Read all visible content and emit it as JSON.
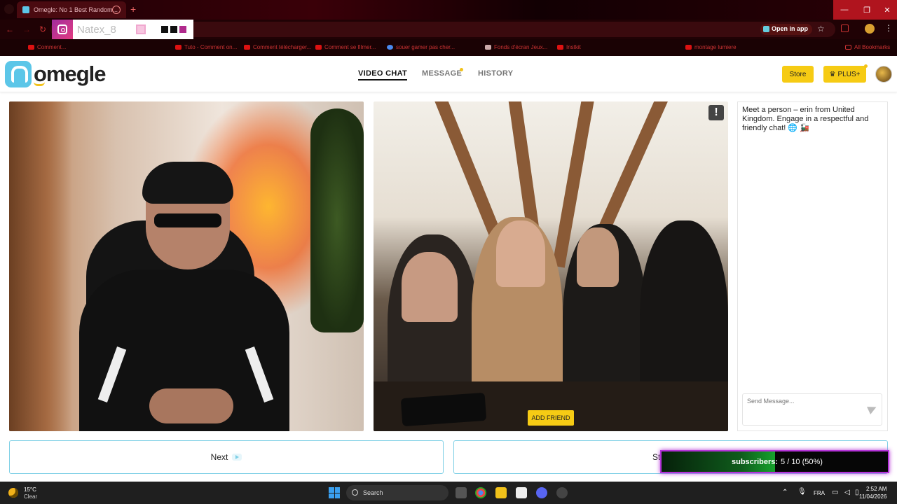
{
  "browser": {
    "tab_title": "Omegle: No 1 Best Random...",
    "open_in_app": "Open in app",
    "bookmarks": [
      "Comment...",
      "Tuto - Comment on...",
      "Comment télécharger...",
      "Comment se filmer...",
      "souer gamer pas cher...",
      "Fonds d'écran Jeux...",
      "Instkit",
      "montage lumiere",
      "All Bookmarks"
    ]
  },
  "overlay": {
    "handle": "Natex_8"
  },
  "header": {
    "logo": "omegle",
    "nav": [
      "VIDEO CHAT",
      "MESSAGE",
      "HISTORY"
    ],
    "store_label": "Store",
    "plus_label": "PLUS+"
  },
  "remote_video": {
    "report_label": "!",
    "add_friend_label": "ADD FRIEND"
  },
  "chat": {
    "intro": "Meet a person – erin from United Kingdom. Engage in a respectful and friendly chat! 🌐 🚂",
    "placeholder": "Send Message..."
  },
  "controls": {
    "next_label": "Next",
    "stop_label": "Stop"
  },
  "subscribers": {
    "label": "subscribers:",
    "count": "5 / 10 (50%)",
    "progress": 0.5
  },
  "taskbar": {
    "temperature": "15°C",
    "condition": "Clear",
    "search_label": "Search",
    "language": "FRA",
    "time": "2:52 AM",
    "date": "11/04/2026"
  },
  "colors": {
    "accent_yellow": "#f6cb14",
    "accent_blue": "#7fd0e6",
    "overlay_purple": "#b533d8"
  }
}
